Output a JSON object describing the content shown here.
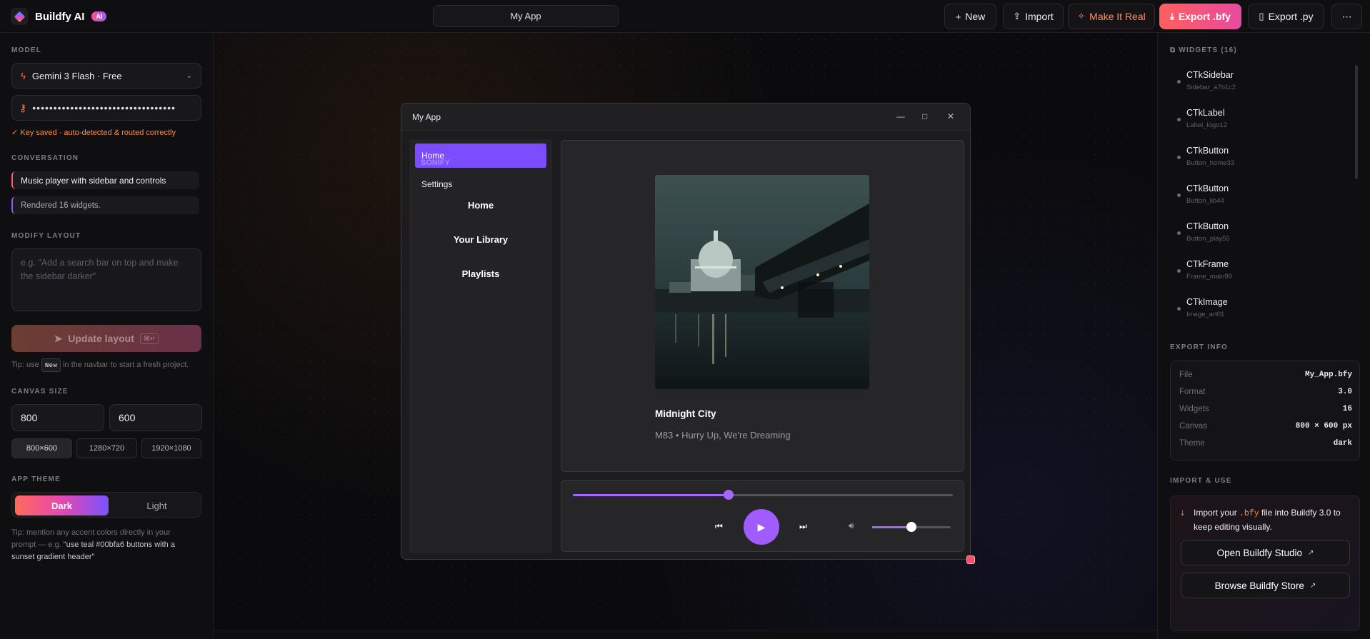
{
  "topbar": {
    "brand": "Buildfy AI",
    "ai_badge": "AI",
    "project_title": "My App",
    "buttons": {
      "new": "New",
      "import": "Import",
      "make_real": "Make It Real",
      "export_bfy": "Export .bfy",
      "export_py": "Export .py"
    }
  },
  "left": {
    "model_label": "MODEL",
    "model_value": "Gemini 3 Flash · Free",
    "api_key_masked": "••••••••••••••••••••••••••••••••••",
    "key_status": "✓ Key saved · auto-detected & routed correctly",
    "conversation_label": "CONVERSATION",
    "conversation": [
      "Music player with sidebar and controls",
      "Rendered 16 widgets."
    ],
    "modify_label": "MODIFY LAYOUT",
    "modify_placeholder": "e.g. \"Add a search bar on top and make the sidebar darker\"",
    "update_button": "Update layout",
    "update_shortcut": "⌘↵",
    "tip1_prefix": "Tip: use",
    "tip1_key": "New",
    "tip1_suffix": "in the navbar to start a fresh project.",
    "canvas_label": "CANVAS SIZE",
    "canvas_width": "800",
    "canvas_height": "600",
    "presets": [
      "800×600",
      "1280×720",
      "1920×1080"
    ],
    "theme_label": "APP THEME",
    "theme_options": [
      "Dark",
      "Light"
    ],
    "tip2_prefix": "Tip: mention any accent colors directly in your prompt — e.g.",
    "tip2_example": "\"use teal #00bfa6 buttons with a sunset gradient header\""
  },
  "app": {
    "window_title": "My App",
    "sidebar": {
      "active": "Home",
      "ghost_logo": "SONIFY",
      "settings": "Settings",
      "nav": [
        "Home",
        "Your Library",
        "Playlists"
      ]
    },
    "track": {
      "title": "Midnight City",
      "artist": "M83 • Hurry Up, We're Dreaming"
    },
    "progress_fraction": 0.41,
    "volume_fraction": 0.5
  },
  "right": {
    "widgets_label": "WIDGETS (16)",
    "widgets": [
      {
        "type": "CTkSidebar",
        "id": "Sidebar_a7b1c2"
      },
      {
        "type": "CTkLabel",
        "id": "Label_logo12"
      },
      {
        "type": "CTkButton",
        "id": "Button_home33"
      },
      {
        "type": "CTkButton",
        "id": "Button_lib44"
      },
      {
        "type": "CTkButton",
        "id": "Button_play55"
      },
      {
        "type": "CTkFrame",
        "id": "Frame_main99"
      },
      {
        "type": "CTkImage",
        "id": "Image_art01"
      }
    ],
    "export_label": "EXPORT INFO",
    "export_info": [
      {
        "k": "File",
        "v": "My_App.bfy"
      },
      {
        "k": "Format",
        "v": "3.0"
      },
      {
        "k": "Widgets",
        "v": "16"
      },
      {
        "k": "Canvas",
        "v": "800 × 600 px"
      },
      {
        "k": "Theme",
        "v": "dark"
      }
    ],
    "import_label": "IMPORT & USE",
    "import_text_a": "Import your",
    "import_code": ".bfy",
    "import_text_b": "file into Buildfy 3.0 to keep editing visually.",
    "open_studio": "Open Buildfy Studio",
    "browse_store": "Browse Buildfy Store"
  },
  "colors": {
    "accent_purple": "#a467ff",
    "sidebar_active": "#7b4dff",
    "export_gradient": [
      "#ff5e5e",
      "#e84aa0"
    ],
    "orange": "#ff8a3d"
  }
}
